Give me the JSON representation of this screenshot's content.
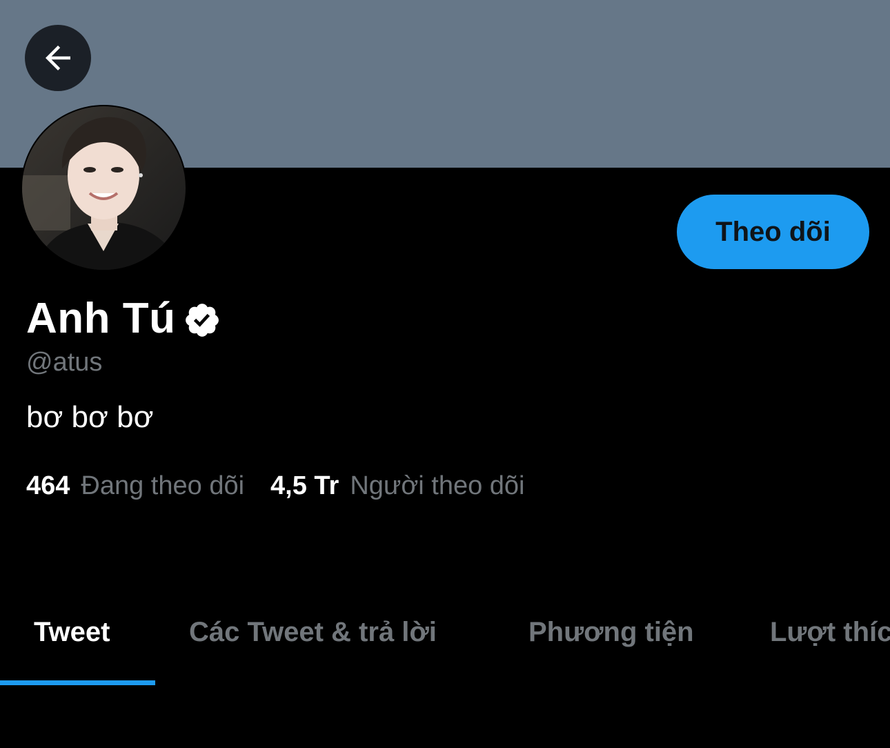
{
  "profile": {
    "display_name": "Anh Tú",
    "handle": "@atus",
    "bio": "bơ bơ bơ",
    "verified": true,
    "follow_label": "Theo dõi",
    "following_count": "464",
    "following_label": "Đang theo dõi",
    "followers_count": "4,5 Tr",
    "followers_label": "Người theo dõi"
  },
  "tabs": [
    {
      "label": "Tweet",
      "active": true
    },
    {
      "label": "Các Tweet & trả lời",
      "active": false
    },
    {
      "label": "Phương tiện",
      "active": false
    },
    {
      "label": "Lượt thích",
      "active": false
    }
  ],
  "colors": {
    "banner": "#667788",
    "accent": "#1d9bf0",
    "background": "#000000",
    "secondary_text": "#71767b"
  },
  "icons": {
    "back": "arrow-left-icon",
    "verified": "verified-badge-icon"
  }
}
